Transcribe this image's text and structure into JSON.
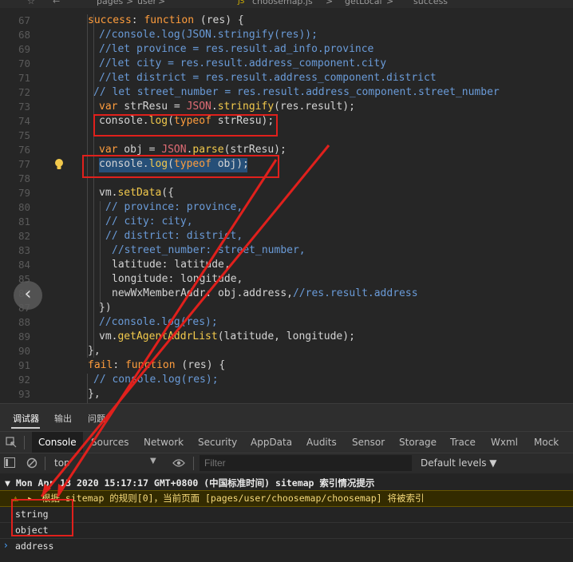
{
  "breadcrumb": {
    "pages": "pages",
    "sep1": ">",
    "user": "user",
    "sep2": ">",
    "file_badge": "JS",
    "file": "choosemap.js",
    "sep3": ">",
    "fn1": "getLocal",
    "sep4": ">",
    "fn2": "success"
  },
  "editor": {
    "lines": [
      {
        "n": "67",
        "c": [
          [
            "kw2",
            "success"
          ],
          [
            "vr",
            ": "
          ],
          [
            "kw",
            "function"
          ],
          [
            "vr",
            " (res) {"
          ]
        ]
      },
      {
        "n": "68",
        "c": [
          [
            "cm",
            "//console.log(JSON.stringify(res));"
          ]
        ]
      },
      {
        "n": "69",
        "c": [
          [
            "cm",
            "//let province = res.result.ad_info.province"
          ]
        ]
      },
      {
        "n": "70",
        "c": [
          [
            "cm",
            "//let city = res.result.address_component.city"
          ]
        ]
      },
      {
        "n": "71",
        "c": [
          [
            "cm",
            "//let district = res.result.address_component.district"
          ]
        ]
      },
      {
        "n": "72",
        "c": [
          [
            "cm",
            "// let street_number = res.result.address_component.street_number"
          ]
        ]
      },
      {
        "n": "73",
        "c": [
          [
            "kw",
            "var"
          ],
          [
            "vr",
            " strResu = "
          ],
          [
            "st",
            "JSON"
          ],
          [
            "vr",
            "."
          ],
          [
            "fn",
            "stringify"
          ],
          [
            "vr",
            "(res.result);"
          ]
        ]
      },
      {
        "n": "74",
        "c": [
          [
            "vr",
            "console."
          ],
          [
            "fn",
            "log"
          ],
          [
            "vr",
            "("
          ],
          [
            "kw",
            "typeof"
          ],
          [
            "vr",
            " strResu);"
          ]
        ]
      },
      {
        "n": "75",
        "c": []
      },
      {
        "n": "76",
        "c": [
          [
            "kw",
            "var"
          ],
          [
            "vr",
            " obj = "
          ],
          [
            "st",
            "JSON"
          ],
          [
            "vr",
            "."
          ],
          [
            "fn",
            "parse"
          ],
          [
            "vr",
            "(strResu);"
          ]
        ]
      },
      {
        "n": "77",
        "c": [
          [
            "vr",
            "console."
          ],
          [
            "fn",
            "log"
          ],
          [
            "vr",
            "("
          ],
          [
            "kw",
            "typeof"
          ],
          [
            "vr",
            " obj);"
          ]
        ]
      },
      {
        "n": "78",
        "c": []
      },
      {
        "n": "79",
        "c": [
          [
            "vr",
            "vm."
          ],
          [
            "fn",
            "setData"
          ],
          [
            "vr",
            "({"
          ]
        ]
      },
      {
        "n": "80",
        "c": [
          [
            "cm",
            "// province: province,"
          ]
        ]
      },
      {
        "n": "81",
        "c": [
          [
            "cm",
            "// city: city,"
          ]
        ]
      },
      {
        "n": "82",
        "c": [
          [
            "cm",
            "// district: district,"
          ]
        ]
      },
      {
        "n": "83",
        "c": [
          [
            "cm",
            "//street_number: street_number,"
          ]
        ]
      },
      {
        "n": "84",
        "c": [
          [
            "vr",
            "latitude: latitude,"
          ]
        ]
      },
      {
        "n": "85",
        "c": [
          [
            "vr",
            "longitude: longitude,"
          ]
        ]
      },
      {
        "n": "86",
        "c": [
          [
            "vr",
            "newWxMemberAddr: obj.address,"
          ],
          [
            "cm",
            "//res.result.address"
          ]
        ]
      },
      {
        "n": "87",
        "c": [
          [
            "vr",
            "})"
          ]
        ]
      },
      {
        "n": "88",
        "c": [
          [
            "cm",
            "//console.log(res);"
          ]
        ]
      },
      {
        "n": "89",
        "c": [
          [
            "vr",
            "vm."
          ],
          [
            "fn",
            "getAgentAddrList"
          ],
          [
            "vr",
            "(latitude, longitude);"
          ]
        ]
      },
      {
        "n": "90",
        "c": [
          [
            "vr",
            "},"
          ]
        ]
      },
      {
        "n": "91",
        "c": [
          [
            "kw2",
            "fail"
          ],
          [
            "vr",
            ": "
          ],
          [
            "kw",
            "function"
          ],
          [
            "vr",
            " (res) {"
          ]
        ]
      },
      {
        "n": "92",
        "c": [
          [
            "cm",
            "// console.log(res);"
          ]
        ]
      },
      {
        "n": "93",
        "c": [
          [
            "vr",
            "},"
          ]
        ]
      }
    ]
  },
  "devtools": {
    "top_tabs": [
      "调试器",
      "输出",
      "问题"
    ],
    "panel_tabs": [
      "Console",
      "Sources",
      "Network",
      "Security",
      "AppData",
      "Audits",
      "Sensor",
      "Storage",
      "Trace",
      "Wxml",
      "Mock"
    ],
    "context": "top",
    "filter_placeholder": "Filter",
    "levels": "Default levels ▼"
  },
  "console": {
    "group_header": "▼ Mon Apr 13 2020 15:17:17 GMT+0800 (中国标准时间) sitemap 索引情况提示",
    "warning": "根据 sitemap 的规则[0]，当前页面 [pages/user/choosemap/choosemap] 将被索引",
    "out1": "string",
    "out2": "object",
    "prompt_text": "address"
  },
  "colors": {
    "highlight_box": "#e0201c",
    "arrow": "#e0201c",
    "selection": "#264f78"
  },
  "icons": [
    "inspect-icon",
    "device-icon",
    "sidebar-toggle-icon",
    "clear-console-icon",
    "eye-icon",
    "warning-icon",
    "lightbulb-icon",
    "chevron-left-icon",
    "prompt-chevron-icon"
  ]
}
